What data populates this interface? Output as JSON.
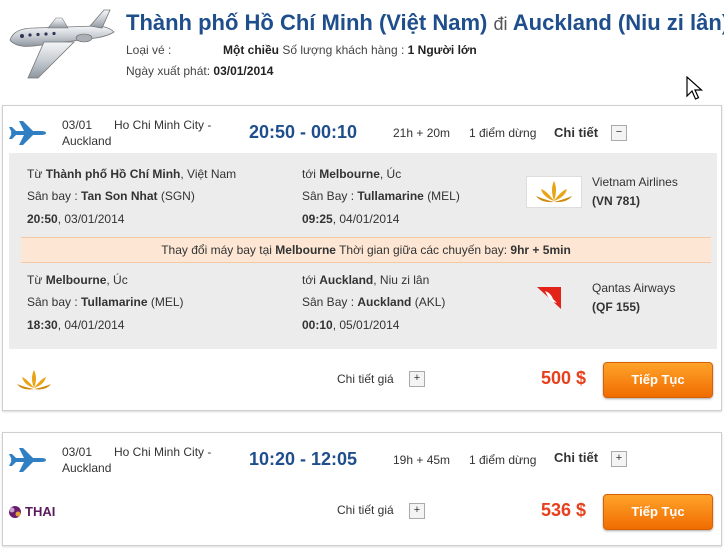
{
  "header": {
    "origin": "Thành phố Hồ Chí Minh (Việt Nam)",
    "connector": "đi",
    "destination": "Auckland (Niu zi lân)",
    "ticket_type_label": "Loại vé :",
    "ticket_type_value": "Một chiều",
    "passengers_label": "Số lượng khách hàng :",
    "passengers_value": "1 Người lớn",
    "departure_label": "Ngày xuất phát:",
    "departure_value": "03/01/2014"
  },
  "flights": [
    {
      "date": "03/01",
      "route_line1": "Ho Chi Minh City -",
      "route_line2": "Auckland",
      "times": "20:50 - 00:10",
      "duration": "21h + 20m",
      "stops": "1 điểm dừng",
      "detail_link": "Chi tiết",
      "detail_toggle": "−",
      "segments": [
        {
          "from_prefix": "Từ",
          "from_city": "Thành phố Hồ Chí Minh",
          "from_country": ", Việt Nam",
          "from_airport_label": "Sân bay :",
          "from_airport": "Tan Son Nhat",
          "from_code": "(SGN)",
          "from_datetime_time": "20:50",
          "from_datetime_date": ", 03/01/2014",
          "to_prefix": "tới",
          "to_city": "Melbourne",
          "to_country": ", Úc",
          "to_airport_label": "Sân Bay :",
          "to_airport": "Tullamarine",
          "to_code": "(MEL)",
          "to_datetime_time": "09:25",
          "to_datetime_date": ", 04/01/2014",
          "airline": "Vietnam Airlines",
          "flight_no": "(VN 781)"
        },
        {
          "from_prefix": "Từ",
          "from_city": "Melbourne",
          "from_country": ", Úc",
          "from_airport_label": "Sân bay :",
          "from_airport": "Tullamarine",
          "from_code": "(MEL)",
          "from_datetime_time": "18:30",
          "from_datetime_date": ", 04/01/2014",
          "to_prefix": "tới",
          "to_city": "Auckland",
          "to_country": ", Niu zi lân",
          "to_airport_label": "Sân Bay :",
          "to_airport": "Auckland",
          "to_code": "(AKL)",
          "to_datetime_time": "00:10",
          "to_datetime_date": ", 05/01/2014",
          "airline": "Qantas Airways",
          "flight_no": "(QF 155)"
        }
      ],
      "transfer": {
        "prefix": "Thay đổi máy bay tại",
        "city": "Melbourne",
        "middle": "Thời gian giữa các chuyến bay:",
        "duration": "9hr + 5min"
      },
      "price_detail": "Chi tiết giá",
      "price_toggle": "+",
      "price": "500 $",
      "continue": "Tiếp Tục"
    },
    {
      "date": "03/01",
      "route_line1": "Ho Chi Minh City -",
      "route_line2": "Auckland",
      "times": "10:20 - 12:05",
      "duration": "19h + 45m",
      "stops": "1 điểm dừng",
      "detail_link": "Chi tiết",
      "detail_toggle": "+",
      "airline_logo_text": "THAI",
      "price_detail": "Chi tiết giá",
      "price_toggle": "+",
      "price": "536 $",
      "continue": "Tiếp Tục"
    }
  ],
  "colors": {
    "primary_blue": "#1f4e8c",
    "price_red": "#e8401c",
    "button_orange": "#f08000",
    "transfer_bg": "#fde7d4",
    "detail_bg": "#ececec"
  }
}
